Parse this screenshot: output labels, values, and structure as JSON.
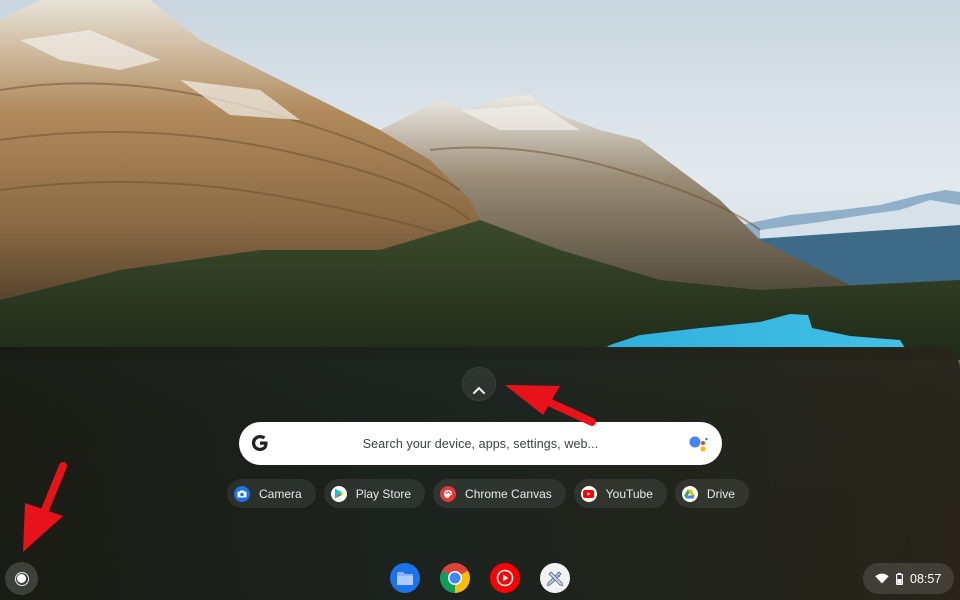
{
  "search": {
    "placeholder": "Search your device, apps, settings, web...",
    "google_logo_icon": "google-g-icon",
    "assistant_icon": "google-assistant-icon"
  },
  "expand_button": {
    "icon": "chevron-up-icon",
    "label": "Expand launcher"
  },
  "suggested_apps": [
    {
      "label": "Camera",
      "icon": "camera-icon",
      "color": "#1a73e8"
    },
    {
      "label": "Play Store",
      "icon": "play-store-icon",
      "color": "#ffffff"
    },
    {
      "label": "Chrome Canvas",
      "icon": "chrome-canvas-icon",
      "color": "#e53935"
    },
    {
      "label": "YouTube",
      "icon": "youtube-icon",
      "color": "#ffffff"
    },
    {
      "label": "Drive",
      "icon": "drive-icon",
      "color": "#ffffff"
    }
  ],
  "shelf": {
    "launcher_icon": "launcher-circle-icon",
    "pinned_apps": [
      {
        "name": "Files",
        "icon": "files-icon",
        "color": "#1a73e8"
      },
      {
        "name": "Chrome",
        "icon": "chrome-icon",
        "color": "#4285f4"
      },
      {
        "name": "YouTube Music",
        "icon": "youtube-music-icon",
        "color": "#ff0000"
      },
      {
        "name": "Chrome Canvas",
        "icon": "canvas-pencil-icon",
        "color": "#f1f3f4"
      }
    ]
  },
  "status_tray": {
    "wifi_icon": "wifi-icon",
    "battery_icon": "battery-icon",
    "time": "08:57"
  },
  "annotations": {
    "arrow_color": "#e8121a"
  }
}
